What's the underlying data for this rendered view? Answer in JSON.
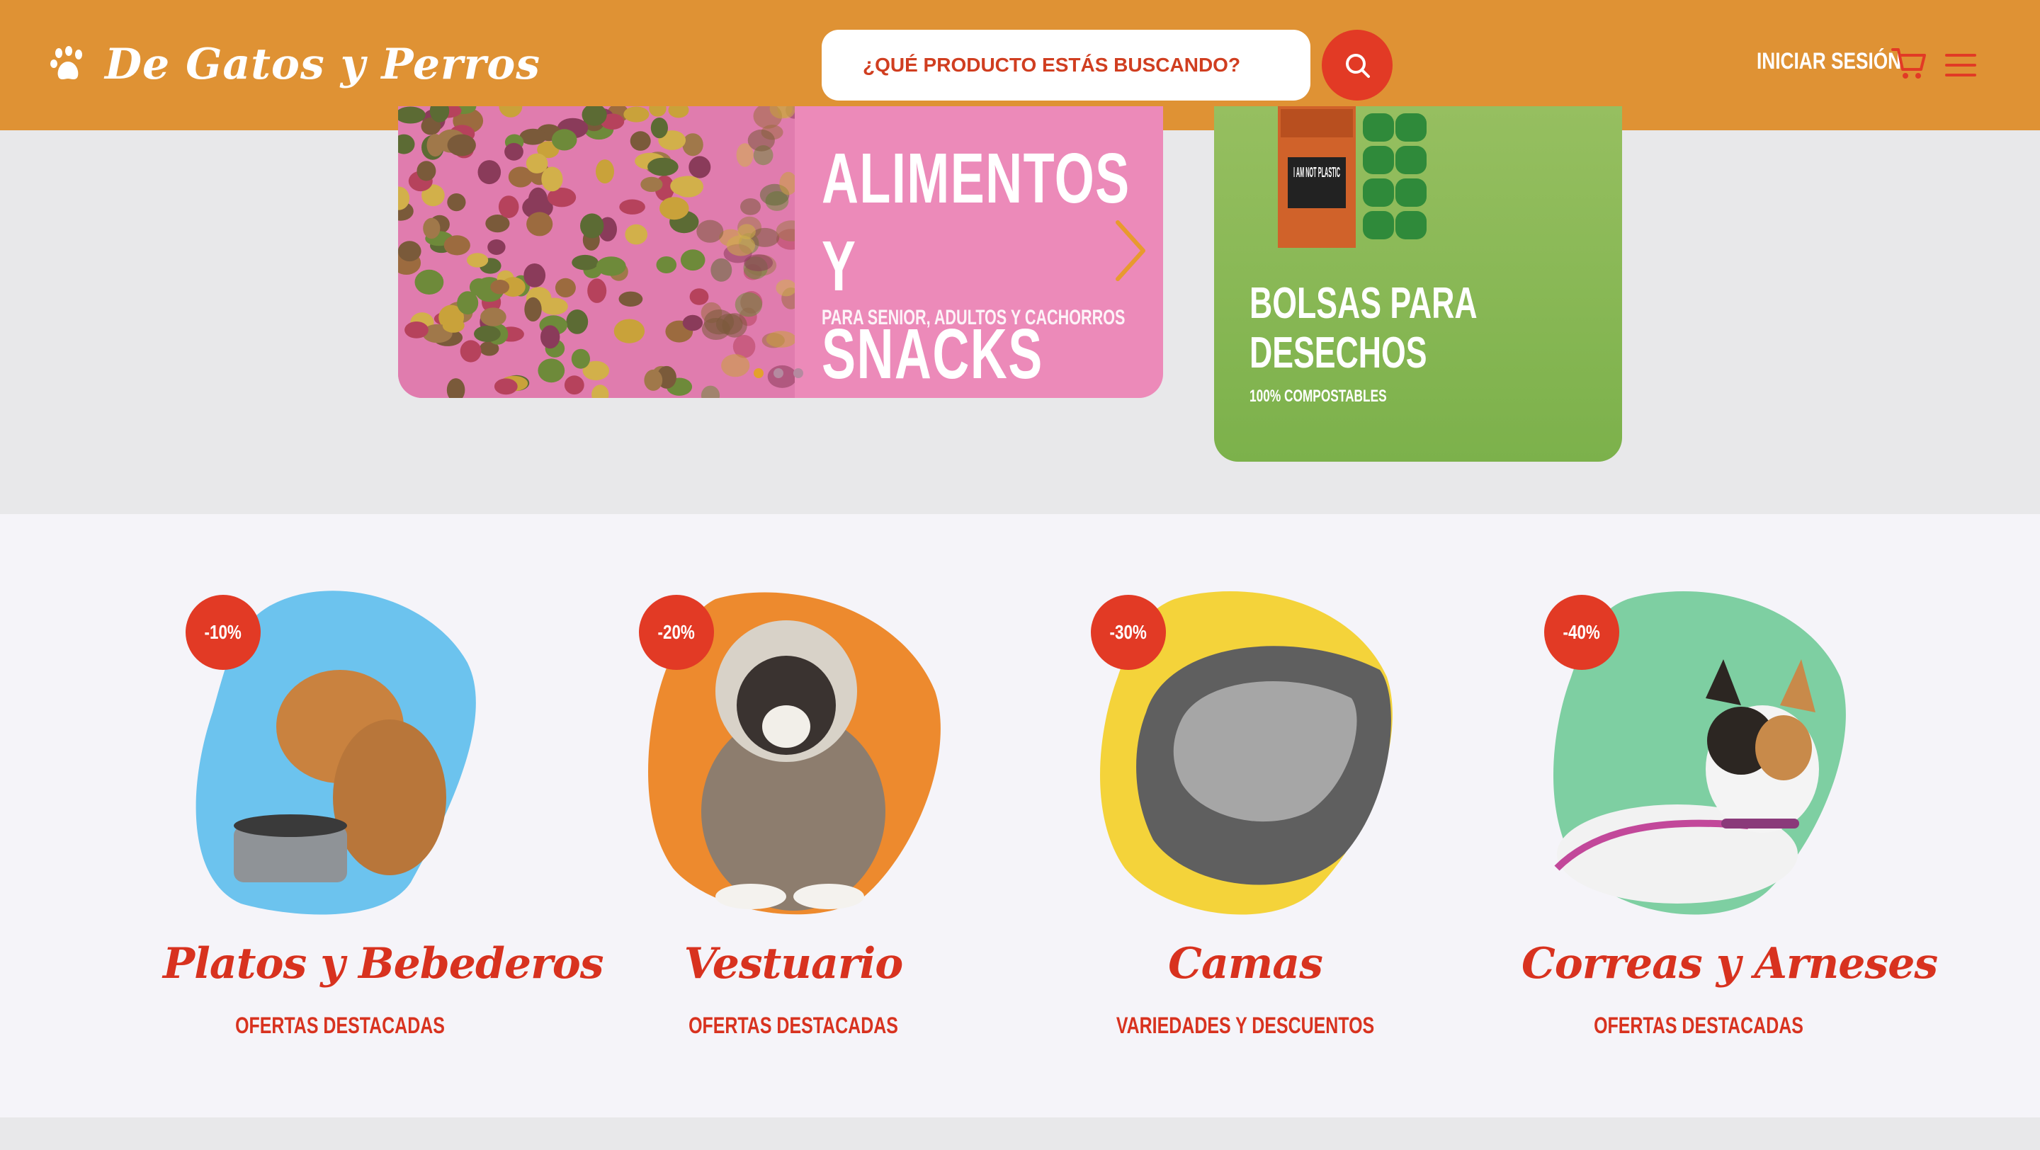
{
  "header": {
    "brand": "De Gatos y Perros",
    "search_placeholder": "¿QUÉ PRODUCTO ESTÁS BUSCANDO?",
    "login_label": "INICIAR SESIÓN",
    "icons": [
      "paw-icon",
      "search-icon",
      "cart-icon",
      "menu-icon"
    ],
    "accent": "#df9234",
    "button_color": "#e23a25"
  },
  "main_banner": {
    "title": "ALIMENTOS Y SNACKS",
    "subtitle": "PARA SENIOR, ADULTOS Y CACHORROS",
    "slides": 3,
    "active_slide": 1,
    "background": "#ec8ab9"
  },
  "side_banner": {
    "title": "BOLSAS PARA DESECHOS",
    "subtitle": "100% COMPOSTABLES",
    "product_text": "I AM NOT PLASTIC",
    "background": "#7cb14b"
  },
  "offers": [
    {
      "badge": "-10%",
      "title": "Platos y Bebederos",
      "subtitle": "OFERTAS DESTACADAS",
      "color": "#6cc3ee"
    },
    {
      "badge": "-20%",
      "title": "Vestuario",
      "subtitle": "OFERTAS DESTACADAS",
      "color": "#ed8a2e"
    },
    {
      "badge": "-30%",
      "title": "Camas",
      "subtitle": "VARIEDADES Y DESCUENTOS",
      "color": "#f4d33a"
    },
    {
      "badge": "-40%",
      "title": "Correas y Arneses",
      "subtitle": "OFERTAS DESTACADAS",
      "color": "#7ecfa2"
    }
  ]
}
